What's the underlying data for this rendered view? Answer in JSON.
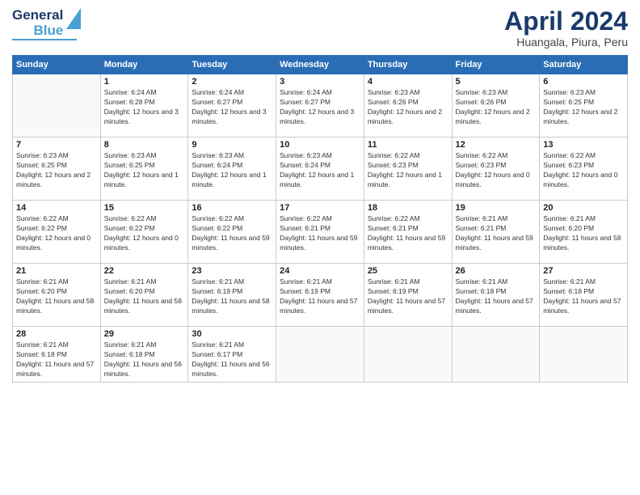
{
  "header": {
    "logo_line1": "General",
    "logo_line2": "Blue",
    "title": "April 2024",
    "subtitle": "Huangala, Piura, Peru"
  },
  "weekdays": [
    "Sunday",
    "Monday",
    "Tuesday",
    "Wednesday",
    "Thursday",
    "Friday",
    "Saturday"
  ],
  "rows": [
    [
      {
        "day": "",
        "empty": true
      },
      {
        "day": "1",
        "sunrise": "6:24 AM",
        "sunset": "6:28 PM",
        "daylight": "12 hours and 3 minutes."
      },
      {
        "day": "2",
        "sunrise": "6:24 AM",
        "sunset": "6:27 PM",
        "daylight": "12 hours and 3 minutes."
      },
      {
        "day": "3",
        "sunrise": "6:24 AM",
        "sunset": "6:27 PM",
        "daylight": "12 hours and 3 minutes."
      },
      {
        "day": "4",
        "sunrise": "6:23 AM",
        "sunset": "6:26 PM",
        "daylight": "12 hours and 2 minutes."
      },
      {
        "day": "5",
        "sunrise": "6:23 AM",
        "sunset": "6:26 PM",
        "daylight": "12 hours and 2 minutes."
      },
      {
        "day": "6",
        "sunrise": "6:23 AM",
        "sunset": "6:25 PM",
        "daylight": "12 hours and 2 minutes."
      }
    ],
    [
      {
        "day": "7",
        "sunrise": "6:23 AM",
        "sunset": "6:25 PM",
        "daylight": "12 hours and 2 minutes."
      },
      {
        "day": "8",
        "sunrise": "6:23 AM",
        "sunset": "6:25 PM",
        "daylight": "12 hours and 1 minute."
      },
      {
        "day": "9",
        "sunrise": "6:23 AM",
        "sunset": "6:24 PM",
        "daylight": "12 hours and 1 minute."
      },
      {
        "day": "10",
        "sunrise": "6:23 AM",
        "sunset": "6:24 PM",
        "daylight": "12 hours and 1 minute."
      },
      {
        "day": "11",
        "sunrise": "6:22 AM",
        "sunset": "6:23 PM",
        "daylight": "12 hours and 1 minute."
      },
      {
        "day": "12",
        "sunrise": "6:22 AM",
        "sunset": "6:23 PM",
        "daylight": "12 hours and 0 minutes."
      },
      {
        "day": "13",
        "sunrise": "6:22 AM",
        "sunset": "6:23 PM",
        "daylight": "12 hours and 0 minutes."
      }
    ],
    [
      {
        "day": "14",
        "sunrise": "6:22 AM",
        "sunset": "6:22 PM",
        "daylight": "12 hours and 0 minutes."
      },
      {
        "day": "15",
        "sunrise": "6:22 AM",
        "sunset": "6:22 PM",
        "daylight": "12 hours and 0 minutes."
      },
      {
        "day": "16",
        "sunrise": "6:22 AM",
        "sunset": "6:22 PM",
        "daylight": "11 hours and 59 minutes."
      },
      {
        "day": "17",
        "sunrise": "6:22 AM",
        "sunset": "6:21 PM",
        "daylight": "11 hours and 59 minutes."
      },
      {
        "day": "18",
        "sunrise": "6:22 AM",
        "sunset": "6:21 PM",
        "daylight": "11 hours and 59 minutes."
      },
      {
        "day": "19",
        "sunrise": "6:21 AM",
        "sunset": "6:21 PM",
        "daylight": "11 hours and 59 minutes."
      },
      {
        "day": "20",
        "sunrise": "6:21 AM",
        "sunset": "6:20 PM",
        "daylight": "11 hours and 58 minutes."
      }
    ],
    [
      {
        "day": "21",
        "sunrise": "6:21 AM",
        "sunset": "6:20 PM",
        "daylight": "11 hours and 58 minutes."
      },
      {
        "day": "22",
        "sunrise": "6:21 AM",
        "sunset": "6:20 PM",
        "daylight": "11 hours and 58 minutes."
      },
      {
        "day": "23",
        "sunrise": "6:21 AM",
        "sunset": "6:19 PM",
        "daylight": "11 hours and 58 minutes."
      },
      {
        "day": "24",
        "sunrise": "6:21 AM",
        "sunset": "6:19 PM",
        "daylight": "11 hours and 57 minutes."
      },
      {
        "day": "25",
        "sunrise": "6:21 AM",
        "sunset": "6:19 PM",
        "daylight": "11 hours and 57 minutes."
      },
      {
        "day": "26",
        "sunrise": "6:21 AM",
        "sunset": "6:18 PM",
        "daylight": "11 hours and 57 minutes."
      },
      {
        "day": "27",
        "sunrise": "6:21 AM",
        "sunset": "6:18 PM",
        "daylight": "11 hours and 57 minutes."
      }
    ],
    [
      {
        "day": "28",
        "sunrise": "6:21 AM",
        "sunset": "6:18 PM",
        "daylight": "11 hours and 57 minutes."
      },
      {
        "day": "29",
        "sunrise": "6:21 AM",
        "sunset": "6:18 PM",
        "daylight": "11 hours and 56 minutes."
      },
      {
        "day": "30",
        "sunrise": "6:21 AM",
        "sunset": "6:17 PM",
        "daylight": "11 hours and 56 minutes."
      },
      {
        "day": "",
        "empty": true
      },
      {
        "day": "",
        "empty": true
      },
      {
        "day": "",
        "empty": true
      },
      {
        "day": "",
        "empty": true
      }
    ]
  ]
}
